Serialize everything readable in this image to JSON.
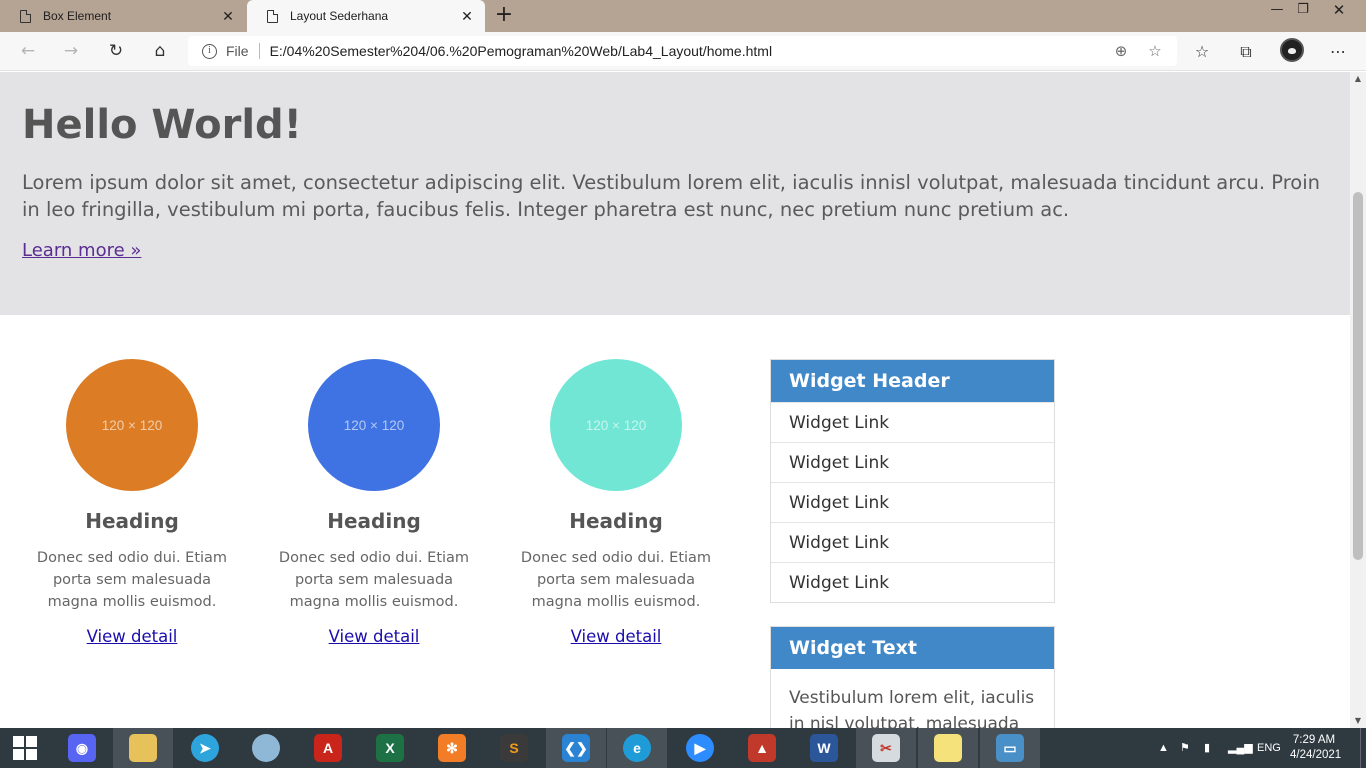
{
  "browser": {
    "tabs": [
      {
        "title": "Box Element",
        "active": false
      },
      {
        "title": "Layout Sederhana",
        "active": true
      }
    ],
    "new_tab_label": "+",
    "address": {
      "scheme_label": "File",
      "url": "E:/04%20Semester%204/06.%20Pemograman%20Web/Lab4_Layout/home.html"
    },
    "icons": {
      "back": "back-arrow-icon",
      "forward": "forward-arrow-icon",
      "refresh": "refresh-icon",
      "home": "home-icon",
      "zoom": "zoom-icon",
      "favorite_add": "add-favorite-icon",
      "favorites": "favorites-icon",
      "collections": "collections-icon",
      "profile": "profile-avatar",
      "more": "more-icon"
    }
  },
  "page": {
    "jumbotron": {
      "title": "Hello World!",
      "text": "Lorem ipsum dolor sit amet, consectetur adipiscing elit. Vestibulum lorem elit, iaculis innisl volutpat, malesuada tincidunt arcu. Proin in leo fringilla, vestibulum mi porta, faucibus felis. Integer pharetra est nunc, nec pretium nunc pretium ac.",
      "link": "Learn more »"
    },
    "features": [
      {
        "image_label": "120 × 120",
        "color": "#dc7d26",
        "heading": "Heading",
        "text": "Donec sed odio dui. Etiam porta sem malesuada magna mollis euismod.",
        "link": "View detail"
      },
      {
        "image_label": "120 × 120",
        "color": "#3f73e3",
        "heading": "Heading",
        "text": "Donec sed odio dui. Etiam porta sem malesuada magna mollis euismod.",
        "link": "View detail"
      },
      {
        "image_label": "120 × 120",
        "color": "#71e6d5",
        "heading": "Heading",
        "text": "Donec sed odio dui. Etiam porta sem malesuada magna mollis euismod.",
        "link": "View detail"
      }
    ],
    "widget_links": {
      "header": "Widget Header",
      "links": [
        "Widget Link",
        "Widget Link",
        "Widget Link",
        "Widget Link",
        "Widget Link"
      ]
    },
    "widget_text": {
      "header": "Widget Text",
      "text": "Vestibulum lorem elit, iaculis in nisl volutpat, malesuada"
    }
  },
  "taskbar": {
    "apps": [
      "Discord",
      "File Explorer",
      "Telegram",
      "Paint",
      "Acrobat",
      "Excel",
      "XAMPP",
      "Sublime Text",
      "Visual Studio Code",
      "Microsoft Edge",
      "Zoom",
      "MATLAB",
      "Word",
      "Snipping Tool",
      "Sticky Notes",
      "Photos"
    ],
    "language": "ENG",
    "time": "7:29 AM",
    "date": "4/24/2021"
  },
  "colors": {
    "tabstrip": "#b5a393",
    "jumbotron_bg": "#e3e3e6",
    "widget_header": "#4188c9",
    "link": "#1a0dab",
    "visited_link": "#5b2c91"
  }
}
